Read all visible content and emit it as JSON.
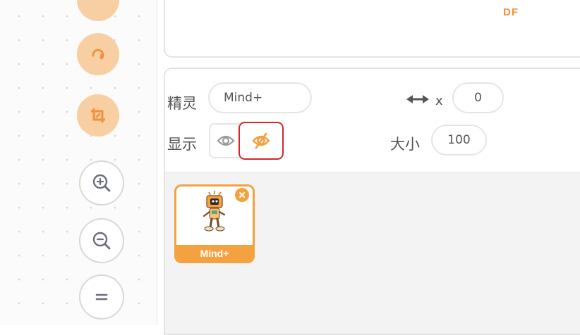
{
  "watermark": "DF",
  "sprite_info": {
    "sprite_label": "精灵",
    "sprite_name": "Mind+",
    "show_label": "显示",
    "x_label": "x",
    "x_value": "0",
    "size_label": "大小",
    "size_value": "100"
  },
  "sprites": [
    {
      "name": "Mind+"
    }
  ],
  "colors": {
    "accent": "#f3a23f",
    "highlight": "#d7262b",
    "button_bg": "#f8cfa2"
  },
  "icons": {
    "rotate": "rotate-icon",
    "crop": "crop-icon",
    "zoom_in": "zoom-in-icon",
    "zoom_out": "zoom-out-icon",
    "reset_zoom": "equals-icon",
    "show": "eye-icon",
    "hide": "eye-slash-icon",
    "arrows": "horizontal-arrows-icon",
    "delete": "close-icon"
  }
}
